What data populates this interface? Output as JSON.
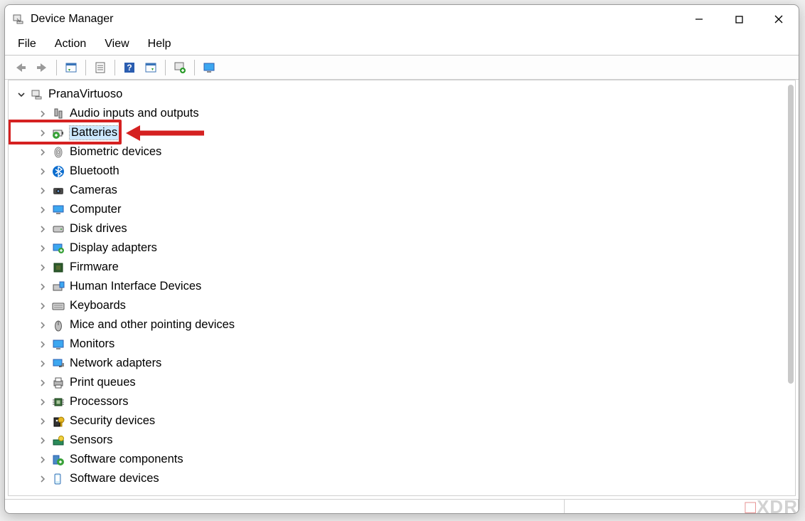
{
  "window": {
    "title": "Device Manager"
  },
  "menu": {
    "file": "File",
    "action": "Action",
    "view": "View",
    "help": "Help"
  },
  "tree": {
    "root": "PranaVirtuoso",
    "categories": [
      {
        "icon": "audio",
        "label": "Audio inputs and outputs"
      },
      {
        "icon": "battery",
        "label": "Batteries",
        "selected": true,
        "highlighted": true
      },
      {
        "icon": "biometric",
        "label": "Biometric devices"
      },
      {
        "icon": "bluetooth",
        "label": "Bluetooth"
      },
      {
        "icon": "camera",
        "label": "Cameras"
      },
      {
        "icon": "computer",
        "label": "Computer"
      },
      {
        "icon": "disk",
        "label": "Disk drives"
      },
      {
        "icon": "display",
        "label": "Display adapters"
      },
      {
        "icon": "firmware",
        "label": "Firmware"
      },
      {
        "icon": "hid",
        "label": "Human Interface Devices"
      },
      {
        "icon": "keyboard",
        "label": "Keyboards"
      },
      {
        "icon": "mouse",
        "label": "Mice and other pointing devices"
      },
      {
        "icon": "monitor",
        "label": "Monitors"
      },
      {
        "icon": "network",
        "label": "Network adapters"
      },
      {
        "icon": "printer",
        "label": "Print queues"
      },
      {
        "icon": "processor",
        "label": "Processors"
      },
      {
        "icon": "security",
        "label": "Security devices"
      },
      {
        "icon": "sensor",
        "label": "Sensors"
      },
      {
        "icon": "softcomp",
        "label": "Software components"
      },
      {
        "icon": "softdev",
        "label": "Software devices"
      }
    ]
  },
  "watermark": {
    "prefix": "□",
    "text": "XDR"
  }
}
